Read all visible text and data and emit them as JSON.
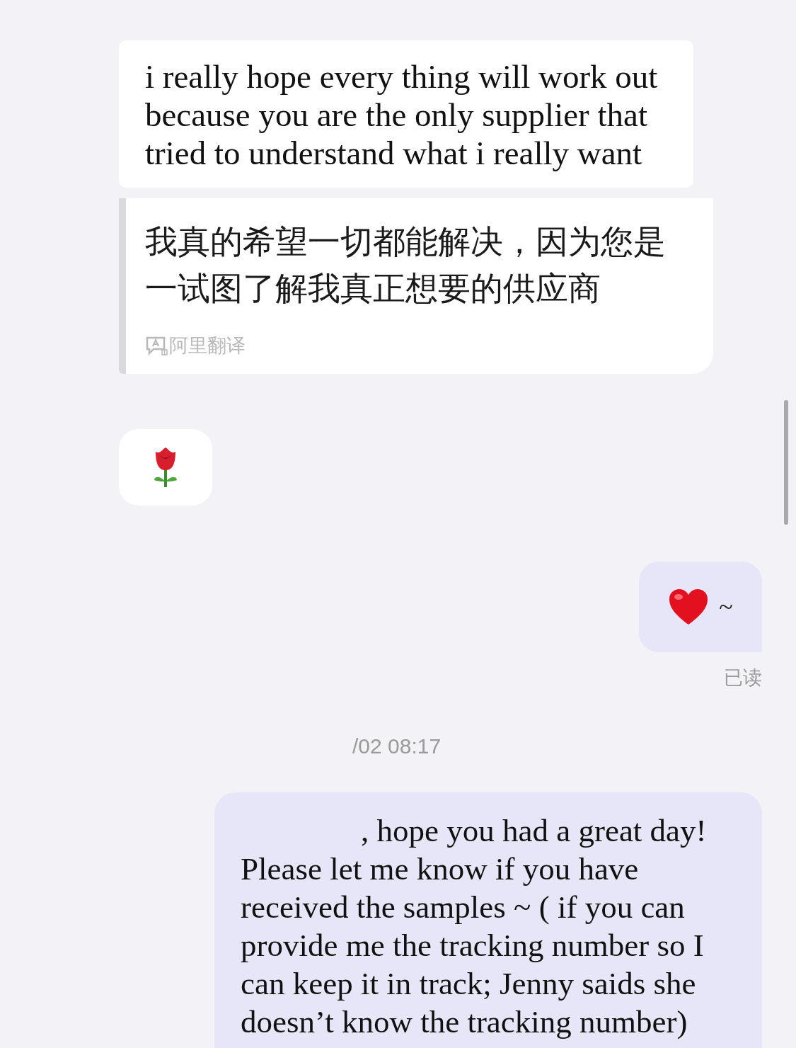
{
  "messages": [
    {
      "kind": "text",
      "outgoing": false,
      "text": "i really hope every thing will work out because you are the only supplier that tried to understand what i really want"
    },
    {
      "kind": "translation",
      "outgoing": false,
      "text": "我真的希望一切都能解决，因为您是一试图了解我真正想要的供应商",
      "source": "阿里翻译"
    },
    {
      "kind": "rose",
      "outgoing": false
    },
    {
      "kind": "heart",
      "outgoing": true,
      "text": "~",
      "status": "已读"
    },
    {
      "kind": "time",
      "text": "/02 08:17"
    },
    {
      "kind": "text",
      "outgoing": true,
      "text": ", hope you had a great day! Please let me know if you have received the samples ~ ( if you can provide me the tracking number so I can keep it in track; Jenny saids she doesn’t know the tracking number)"
    }
  ]
}
